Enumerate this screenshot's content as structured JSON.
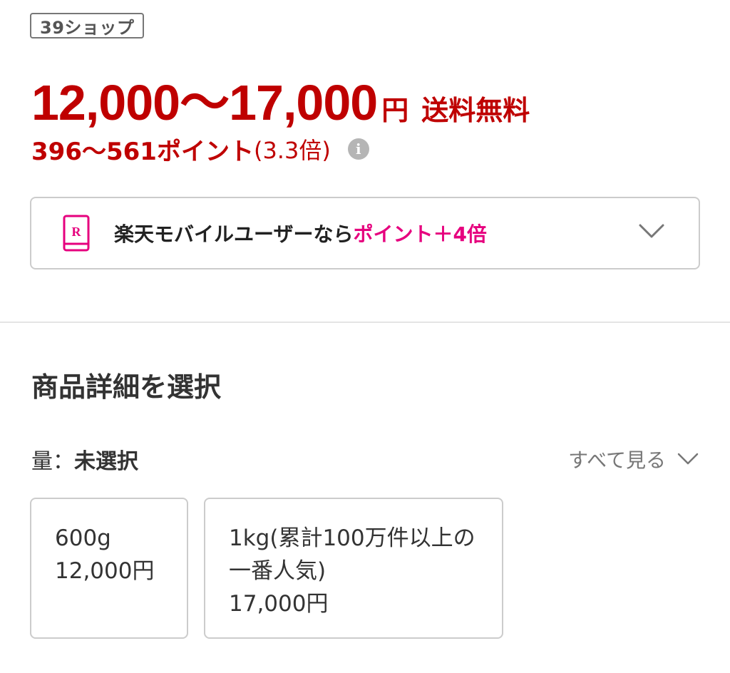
{
  "shop": {
    "badge": "39ショップ"
  },
  "price": {
    "range": "12,000〜17,000",
    "currency": "円",
    "shipping": "送料無料",
    "color": "#bf0000"
  },
  "points": {
    "range": "396〜561ポイント",
    "multiplier": "(3.3倍)",
    "info_icon": "info-icon"
  },
  "promo": {
    "text": "楽天モバイルユーザーなら",
    "highlight": "ポイント＋4倍",
    "highlight_color": "#e6007e",
    "icon": "mobile-phone-icon",
    "icon_letter": "R"
  },
  "selection": {
    "title": "商品詳細を選択",
    "option_name": "量：",
    "option_value": "未選択",
    "see_all": "すべて見る"
  },
  "variants": [
    {
      "name": "600g",
      "price": "12,000円"
    },
    {
      "name": "1kg(累計100万件以上の一番人気)",
      "price": "17,000円"
    }
  ]
}
